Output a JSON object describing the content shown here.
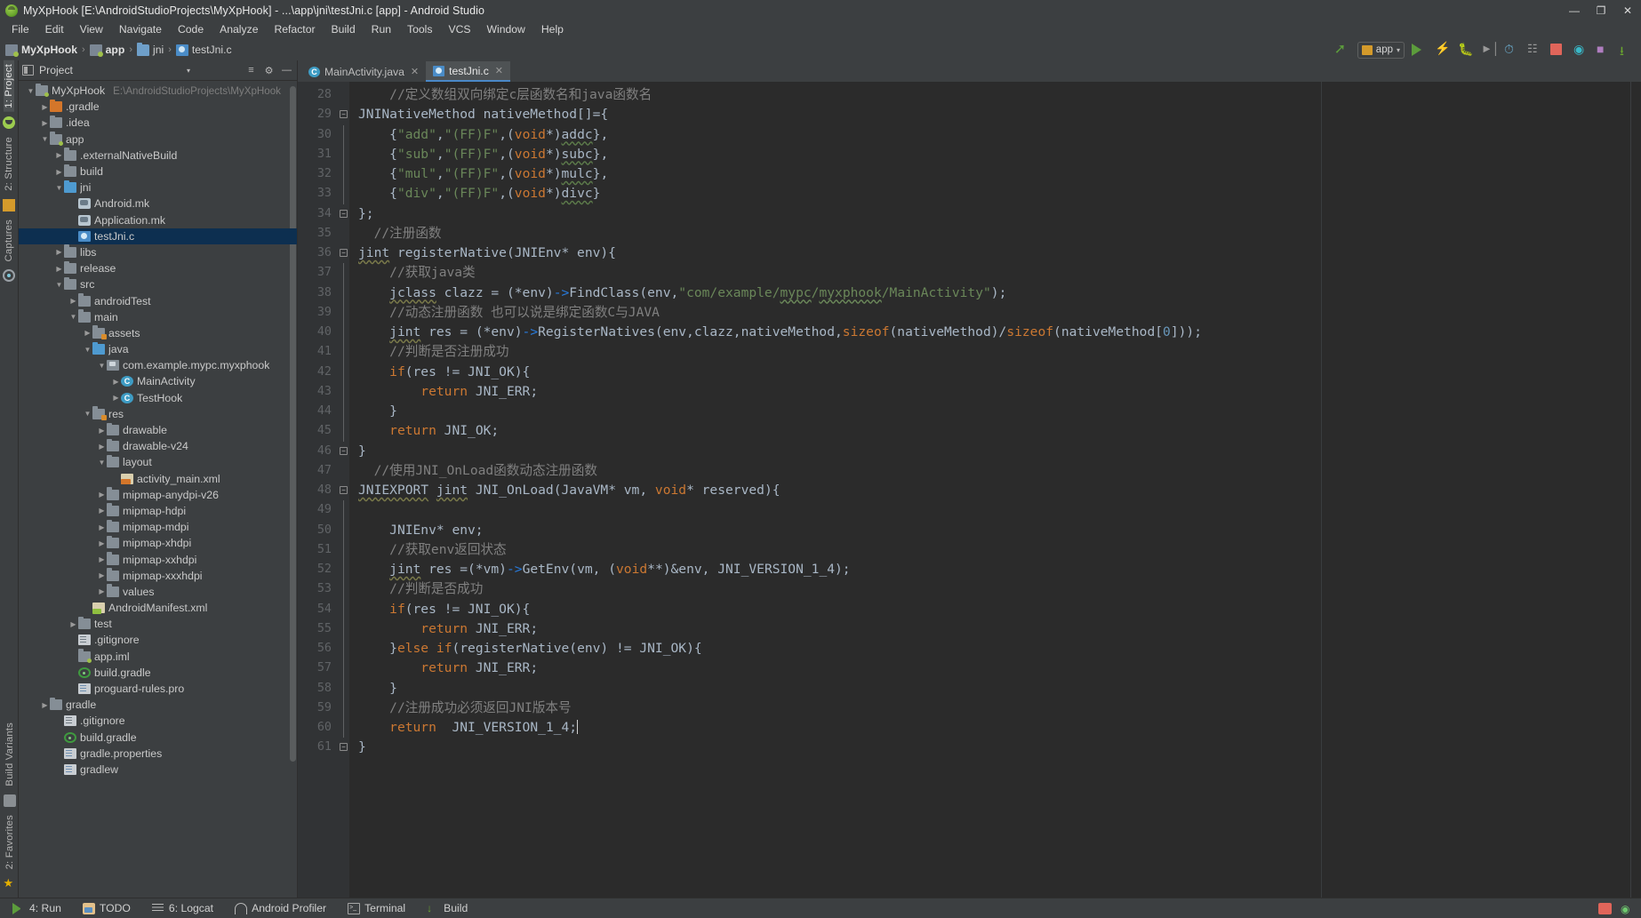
{
  "window": {
    "title": "MyXpHook [E:\\AndroidStudioProjects\\MyXpHook] - ...\\app\\jni\\testJni.c [app] - Android Studio",
    "minimize": "—",
    "maximize": "❐",
    "close": "✕"
  },
  "menubar": [
    {
      "label": "File"
    },
    {
      "label": "Edit"
    },
    {
      "label": "View"
    },
    {
      "label": "Navigate"
    },
    {
      "label": "Code"
    },
    {
      "label": "Analyze"
    },
    {
      "label": "Refactor"
    },
    {
      "label": "Build"
    },
    {
      "label": "Run"
    },
    {
      "label": "Tools"
    },
    {
      "label": "VCS"
    },
    {
      "label": "Window"
    },
    {
      "label": "Help"
    }
  ],
  "breadcrumb": {
    "separator": "›",
    "items": [
      {
        "label": "MyXpHook",
        "icon": "module-icon"
      },
      {
        "label": "app",
        "icon": "module-icon"
      },
      {
        "label": "jni",
        "icon": "folder-icon"
      },
      {
        "label": "testJni.c",
        "icon": "c-file-icon"
      }
    ]
  },
  "toolbar": {
    "run_config": "app",
    "chevron": "▾",
    "buttons": [
      {
        "name": "back-arrow-icon"
      },
      {
        "name": "run-button"
      },
      {
        "name": "apply-changes-icon"
      },
      {
        "name": "debug-button"
      },
      {
        "name": "run-to-cursor-icon"
      },
      {
        "name": "profiler-button"
      },
      {
        "name": "attach-debugger-icon"
      },
      {
        "name": "stop-button"
      },
      {
        "name": "avd-manager-icon"
      },
      {
        "name": "sdk-manager-icon"
      },
      {
        "name": "sync-gradle-icon"
      }
    ]
  },
  "left_strip": {
    "tabs": [
      {
        "label": "1: Project",
        "selected": true
      },
      {
        "label": "2: Structure",
        "selected": false
      },
      {
        "label": "Captures",
        "selected": false
      }
    ],
    "bottom_tabs": [
      {
        "label": "Build Variants"
      },
      {
        "label": "2: Favorites"
      }
    ]
  },
  "project_panel": {
    "title": "Project",
    "chevron": "▾",
    "collapse_icon": "≡",
    "settings_icon": "⚙",
    "hide_icon": "—",
    "tree": [
      {
        "label": "MyXpHook",
        "sub": "E:\\AndroidStudioProjects\\MyXpHook",
        "indent": 0,
        "arrow": "▼",
        "icon": "f-mod",
        "selected": false
      },
      {
        "label": ".gradle",
        "sub": "",
        "indent": 1,
        "arrow": "▶",
        "icon": "f-orange",
        "selected": false
      },
      {
        "label": ".idea",
        "sub": "",
        "indent": 1,
        "arrow": "▶",
        "icon": "f-gray",
        "selected": false
      },
      {
        "label": "app",
        "sub": "",
        "indent": 1,
        "arrow": "▼",
        "icon": "f-mod",
        "selected": false
      },
      {
        "label": ".externalNativeBuild",
        "sub": "",
        "indent": 2,
        "arrow": "▶",
        "icon": "f-gray",
        "selected": false
      },
      {
        "label": "build",
        "sub": "",
        "indent": 2,
        "arrow": "▶",
        "icon": "f-gray",
        "selected": false
      },
      {
        "label": "jni",
        "sub": "",
        "indent": 2,
        "arrow": "▼",
        "icon": "f-blue",
        "selected": false
      },
      {
        "label": "Android.mk",
        "sub": "",
        "indent": 3,
        "arrow": "",
        "icon": "f-mk",
        "selected": false
      },
      {
        "label": "Application.mk",
        "sub": "",
        "indent": 3,
        "arrow": "",
        "icon": "f-mk",
        "selected": false
      },
      {
        "label": "testJni.c",
        "sub": "",
        "indent": 3,
        "arrow": "",
        "icon": "f-c",
        "selected": true
      },
      {
        "label": "libs",
        "sub": "",
        "indent": 2,
        "arrow": "▶",
        "icon": "f-gray",
        "selected": false
      },
      {
        "label": "release",
        "sub": "",
        "indent": 2,
        "arrow": "▶",
        "icon": "f-gray",
        "selected": false
      },
      {
        "label": "src",
        "sub": "",
        "indent": 2,
        "arrow": "▼",
        "icon": "f-gray",
        "selected": false
      },
      {
        "label": "androidTest",
        "sub": "",
        "indent": 3,
        "arrow": "▶",
        "icon": "f-gray",
        "selected": false
      },
      {
        "label": "main",
        "sub": "",
        "indent": 3,
        "arrow": "▼",
        "icon": "f-gray",
        "selected": false
      },
      {
        "label": "assets",
        "sub": "",
        "indent": 4,
        "arrow": "▶",
        "icon": "f-res",
        "selected": false
      },
      {
        "label": "java",
        "sub": "",
        "indent": 4,
        "arrow": "▼",
        "icon": "f-blue",
        "selected": false
      },
      {
        "label": "com.example.mypc.myxphook",
        "sub": "",
        "indent": 5,
        "arrow": "▼",
        "icon": "f-pkg",
        "selected": false
      },
      {
        "label": "MainActivity",
        "sub": "",
        "indent": 6,
        "arrow": "▶",
        "icon": "f-class",
        "selected": false
      },
      {
        "label": "TestHook",
        "sub": "",
        "indent": 6,
        "arrow": "▶",
        "icon": "f-class",
        "selected": false
      },
      {
        "label": "res",
        "sub": "",
        "indent": 4,
        "arrow": "▼",
        "icon": "f-res",
        "selected": false
      },
      {
        "label": "drawable",
        "sub": "",
        "indent": 5,
        "arrow": "▶",
        "icon": "f-gray",
        "selected": false
      },
      {
        "label": "drawable-v24",
        "sub": "",
        "indent": 5,
        "arrow": "▶",
        "icon": "f-gray",
        "selected": false
      },
      {
        "label": "layout",
        "sub": "",
        "indent": 5,
        "arrow": "▼",
        "icon": "f-gray",
        "selected": false
      },
      {
        "label": "activity_main.xml",
        "sub": "",
        "indent": 6,
        "arrow": "",
        "icon": "f-xml",
        "selected": false
      },
      {
        "label": "mipmap-anydpi-v26",
        "sub": "",
        "indent": 5,
        "arrow": "▶",
        "icon": "f-gray",
        "selected": false
      },
      {
        "label": "mipmap-hdpi",
        "sub": "",
        "indent": 5,
        "arrow": "▶",
        "icon": "f-gray",
        "selected": false
      },
      {
        "label": "mipmap-mdpi",
        "sub": "",
        "indent": 5,
        "arrow": "▶",
        "icon": "f-gray",
        "selected": false
      },
      {
        "label": "mipmap-xhdpi",
        "sub": "",
        "indent": 5,
        "arrow": "▶",
        "icon": "f-gray",
        "selected": false
      },
      {
        "label": "mipmap-xxhdpi",
        "sub": "",
        "indent": 5,
        "arrow": "▶",
        "icon": "f-gray",
        "selected": false
      },
      {
        "label": "mipmap-xxxhdpi",
        "sub": "",
        "indent": 5,
        "arrow": "▶",
        "icon": "f-gray",
        "selected": false
      },
      {
        "label": "values",
        "sub": "",
        "indent": 5,
        "arrow": "▶",
        "icon": "f-gray",
        "selected": false
      },
      {
        "label": "AndroidManifest.xml",
        "sub": "",
        "indent": 4,
        "arrow": "",
        "icon": "f-manifest",
        "selected": false
      },
      {
        "label": "test",
        "sub": "",
        "indent": 3,
        "arrow": "▶",
        "icon": "f-gray",
        "selected": false
      },
      {
        "label": ".gitignore",
        "sub": "",
        "indent": 3,
        "arrow": "",
        "icon": "f-git",
        "selected": false
      },
      {
        "label": "app.iml",
        "sub": "",
        "indent": 3,
        "arrow": "",
        "icon": "f-iml",
        "selected": false
      },
      {
        "label": "build.gradle",
        "sub": "",
        "indent": 3,
        "arrow": "",
        "icon": "f-gradle",
        "selected": false
      },
      {
        "label": "proguard-rules.pro",
        "sub": "",
        "indent": 3,
        "arrow": "",
        "icon": "f-props",
        "selected": false
      },
      {
        "label": "gradle",
        "sub": "",
        "indent": 1,
        "arrow": "▶",
        "icon": "f-gray",
        "selected": false
      },
      {
        "label": ".gitignore",
        "sub": "",
        "indent": 2,
        "arrow": "",
        "icon": "f-git",
        "selected": false
      },
      {
        "label": "build.gradle",
        "sub": "",
        "indent": 2,
        "arrow": "",
        "icon": "f-gradle",
        "selected": false
      },
      {
        "label": "gradle.properties",
        "sub": "",
        "indent": 2,
        "arrow": "",
        "icon": "f-props",
        "selected": false
      },
      {
        "label": "gradlew",
        "sub": "",
        "indent": 2,
        "arrow": "",
        "icon": "f-props",
        "selected": false
      }
    ]
  },
  "editor": {
    "tabs": [
      {
        "label": "MainActivity.java",
        "icon": "java-class-icon",
        "active": false,
        "close": "✕"
      },
      {
        "label": "testJni.c",
        "icon": "c-file-icon",
        "active": true,
        "close": "✕"
      }
    ],
    "first_line_number": 28,
    "lines": [
      {
        "n": 28,
        "fold": "",
        "html": "    <span class='cm'>//定义数组双向绑定c层函数名和java函数名</span>"
      },
      {
        "n": 29,
        "fold": "minus",
        "html": "<span class='id'>JNINativeMethod nativeMethod[]={</span>"
      },
      {
        "n": 30,
        "fold": "bar",
        "html": "    <span class='id'>{</span><span class='str'>\"add\"</span><span class='id'>,</span><span class='str'>\"(FF)F\"</span><span class='id'>,(</span><span class='kw'>void</span><span class='id'>*)</span><span class='wavyg'>addc</span><span class='id'>},</span>"
      },
      {
        "n": 31,
        "fold": "bar",
        "html": "    <span class='id'>{</span><span class='str'>\"sub\"</span><span class='id'>,</span><span class='str'>\"(FF)F\"</span><span class='id'>,(</span><span class='kw'>void</span><span class='id'>*)</span><span class='wavyg'>subc</span><span class='id'>},</span>"
      },
      {
        "n": 32,
        "fold": "bar",
        "html": "    <span class='id'>{</span><span class='str'>\"mul\"</span><span class='id'>,</span><span class='str'>\"(FF)F\"</span><span class='id'>,(</span><span class='kw'>void</span><span class='id'>*)</span><span class='wavyg'>mulc</span><span class='id'>},</span>"
      },
      {
        "n": 33,
        "fold": "bar",
        "html": "    <span class='id'>{</span><span class='str'>\"div\"</span><span class='id'>,</span><span class='str'>\"(FF)F\"</span><span class='id'>,(</span><span class='kw'>void</span><span class='id'>*)</span><span class='wavyg'>divc</span><span class='id'>}</span>"
      },
      {
        "n": 34,
        "fold": "plus",
        "html": "<span class='id'>};</span>"
      },
      {
        "n": 35,
        "fold": "",
        "html": "  <span class='cm'>//注册函数</span>"
      },
      {
        "n": 36,
        "fold": "minus",
        "html": "<span class='undl'>jint</span> <span class='id'>registerNative(JNIEnv* env){</span>"
      },
      {
        "n": 37,
        "fold": "bar",
        "html": "    <span class='cm'>//获取java类</span>"
      },
      {
        "n": 38,
        "fold": "bar",
        "html": "    <span class='undl'>jclass</span> <span class='id'>clazz = (*env)</span><span class='arrow-op'>-&gt;</span><span class='id'>FindClass(env,</span><span class='str'>\"com/example/</span><span class='str wavy'>mypc</span><span class='str'>/</span><span class='str wavy'>myxphook</span><span class='str'>/MainActivity\"</span><span class='id'>);</span>"
      },
      {
        "n": 39,
        "fold": "bar",
        "html": "    <span class='cm'>//动态注册函数 也可以说是绑定函数C与JAVA</span>"
      },
      {
        "n": 40,
        "fold": "bar",
        "html": "    <span class='undl'>jint</span> <span class='id'>res = (*env)</span><span class='arrow-op'>-&gt;</span><span class='id'>RegisterNatives(env,clazz,nativeMethod,</span><span class='kw'>sizeof</span><span class='id'>(nativeMethod)/</span><span class='kw'>sizeof</span><span class='id'>(nativeMethod[</span><span class='num'>0</span><span class='id'>]));</span>"
      },
      {
        "n": 41,
        "fold": "bar",
        "html": "    <span class='cm'>//判断是否注册成功</span>"
      },
      {
        "n": 42,
        "fold": "bar",
        "html": "    <span class='kw'>if</span><span class='id'>(res != JNI_OK){</span>"
      },
      {
        "n": 43,
        "fold": "bar",
        "html": "        <span class='kw'>return</span> <span class='id'>JNI_ERR;</span>"
      },
      {
        "n": 44,
        "fold": "bar",
        "html": "    <span class='id'>}</span>"
      },
      {
        "n": 45,
        "fold": "bar",
        "html": "    <span class='kw'>return</span> <span class='id'>JNI_OK;</span>"
      },
      {
        "n": 46,
        "fold": "plus",
        "html": "<span class='id'>}</span>"
      },
      {
        "n": 47,
        "fold": "",
        "html": "  <span class='cm'>//使用JNI_OnLoad函数动态注册函数</span>"
      },
      {
        "n": 48,
        "fold": "minus",
        "html": "<span class='undl'>JNIEXPORT</span> <span class='undl'>jint</span> <span class='id'>JNI_OnLoad(JavaVM* vm, </span><span class='kw'>void</span><span class='id'>* reserved){</span>"
      },
      {
        "n": 49,
        "fold": "bar",
        "html": ""
      },
      {
        "n": 50,
        "fold": "bar",
        "html": "    <span class='id'>JNIEnv* env;</span>"
      },
      {
        "n": 51,
        "fold": "bar",
        "html": "    <span class='cm'>//获取env返回状态</span>"
      },
      {
        "n": 52,
        "fold": "bar",
        "html": "    <span class='undl'>jint</span> <span class='id'>res =(*vm)</span><span class='arrow-op'>-&gt;</span><span class='id'>GetEnv(vm, (</span><span class='kw'>void</span><span class='id'>**)&amp;env, JNI_VERSION_1_4);</span>"
      },
      {
        "n": 53,
        "fold": "bar",
        "html": "    <span class='cm'>//判断是否成功</span>"
      },
      {
        "n": 54,
        "fold": "bar",
        "html": "    <span class='kw'>if</span><span class='id'>(res != JNI_OK){</span>"
      },
      {
        "n": 55,
        "fold": "bar",
        "html": "        <span class='kw'>return</span> <span class='id'>JNI_ERR;</span>"
      },
      {
        "n": 56,
        "fold": "bar",
        "html": "    <span class='id'>}</span><span class='kw'>else</span> <span class='kw'>if</span><span class='id'>(registerNative(env) != JNI_OK){</span>"
      },
      {
        "n": 57,
        "fold": "bar",
        "html": "        <span class='kw'>return</span> <span class='id'>JNI_ERR;</span>"
      },
      {
        "n": 58,
        "fold": "bar",
        "html": "    <span class='id'>}</span>"
      },
      {
        "n": 59,
        "fold": "bar",
        "html": "    <span class='cm'>//注册成功必须返回JNI版本号</span>"
      },
      {
        "n": 60,
        "fold": "bar",
        "html": "    <span class='kw'>return</span>  <span class='id'>JNI_VERSION_1_4;</span><span class='caret'></span>"
      },
      {
        "n": 61,
        "fold": "plus",
        "html": "<span class='id'>}</span>"
      }
    ]
  },
  "statusbar": {
    "items": [
      {
        "label": "4: Run",
        "mnemonic": "4",
        "icon": "run-icon"
      },
      {
        "label": "TODO",
        "mnemonic": "",
        "icon": "todo-icon"
      },
      {
        "label": "6: Logcat",
        "mnemonic": "6",
        "icon": "logcat-icon"
      },
      {
        "label": "Android Profiler",
        "mnemonic": "",
        "icon": "profiler-icon"
      },
      {
        "label": "Terminal",
        "mnemonic": "",
        "icon": "terminal-icon"
      },
      {
        "label": "Build",
        "mnemonic": "",
        "icon": "build-icon"
      }
    ]
  },
  "colors": {
    "background": "#3c3f41",
    "editor_bg": "#2b2b2b",
    "gutter_bg": "#313335",
    "selection": "#0d2f50",
    "accent": "#4a88c7",
    "comment": "#808080",
    "keyword": "#cc7832",
    "string": "#6a8759",
    "number": "#6897bb"
  }
}
